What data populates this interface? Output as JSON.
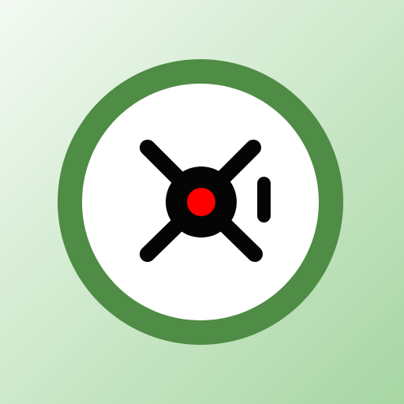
{
  "icon": {
    "name": "vault-safe-dial-icon",
    "colors": {
      "background_start": "#f4faf3",
      "background_end": "#a7d6a3",
      "ring": "#4f8c45",
      "face": "#ffffff",
      "handle": "#050505",
      "center_light": "#ff0000"
    }
  }
}
